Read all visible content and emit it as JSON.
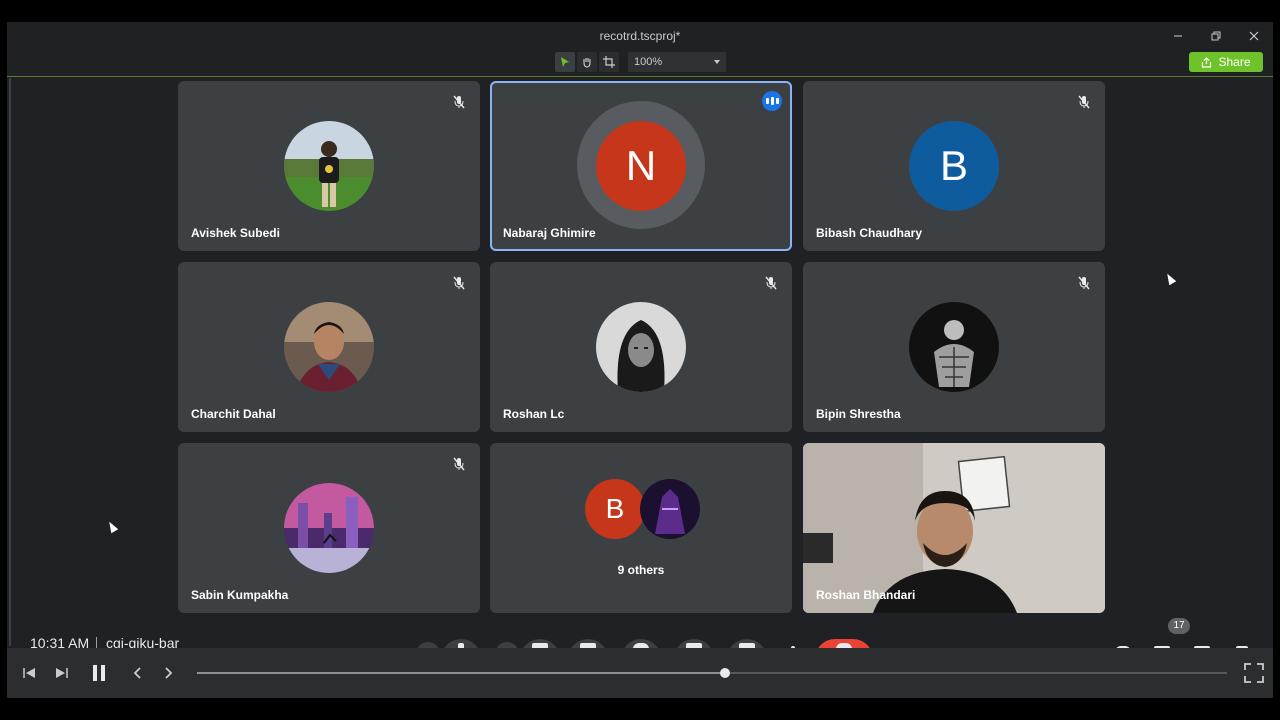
{
  "window": {
    "title": "recotrd.tscproj*",
    "zoom": "100%",
    "share_label": "Share",
    "accent": "#6ec32a"
  },
  "participants": [
    {
      "name": "Avishek Subedi",
      "avatar": "photo-outdoor",
      "muted": true
    },
    {
      "name": "Nabaraj Ghimire",
      "avatar_letter": "N",
      "avatar_color": "#c5361b",
      "speaking": true
    },
    {
      "name": "Bibash Chaudhary",
      "avatar_letter": "B",
      "avatar_color": "#0e5c9e",
      "muted": true
    },
    {
      "name": "Charchit Dahal",
      "avatar": "photo-portrait",
      "muted": true
    },
    {
      "name": "Roshan Lc",
      "avatar": "photo-bw",
      "muted": true
    },
    {
      "name": "Bipin Shrestha",
      "avatar": "photo-sketch",
      "muted": true
    },
    {
      "name": "Sabin Kumpakha",
      "avatar": "photo-art",
      "muted": true
    },
    {
      "others_label": "9 others",
      "avatar_letter": "B",
      "avatar_color": "#c5361b"
    },
    {
      "name": "Roshan Bhandari",
      "video": true
    }
  ],
  "meeting": {
    "time": "10:31 AM",
    "code": "cgi-qiku-bar",
    "people_count": "17"
  },
  "player": {
    "progress": 0.513
  }
}
